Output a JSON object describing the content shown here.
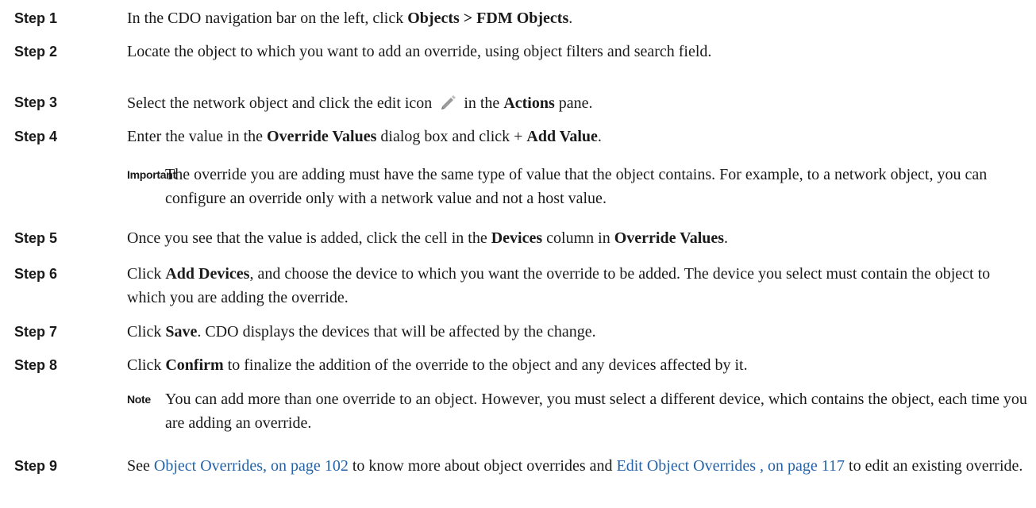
{
  "steps": [
    {
      "label": "Step 1",
      "parts": [
        {
          "t": "In the CDO navigation bar on the left, click "
        },
        {
          "t": "Objects > FDM Objects",
          "b": true
        },
        {
          "t": "."
        }
      ]
    },
    {
      "label": "Step 2",
      "parts": [
        {
          "t": "Locate the object to which you want to add an override, using object filters and search field."
        }
      ]
    },
    {
      "label": "Step 3",
      "parts": [
        {
          "t": "Select the network object and click the edit icon"
        },
        {
          "icon": "pencil-icon"
        },
        {
          "t": "in the "
        },
        {
          "t": "Actions",
          "b": true
        },
        {
          "t": " pane."
        }
      ]
    },
    {
      "label": "Step 4",
      "parts": [
        {
          "t": "Enter the value in the "
        },
        {
          "t": "Override Values",
          "b": true
        },
        {
          "t": " dialog box and click + "
        },
        {
          "t": "Add Value",
          "b": true
        },
        {
          "t": "."
        }
      ]
    },
    {
      "label": "Step 5",
      "parts": [
        {
          "t": "Once you see that the value is added, click the cell in the "
        },
        {
          "t": "Devices",
          "b": true
        },
        {
          "t": " column in "
        },
        {
          "t": "Override Values",
          "b": true
        },
        {
          "t": "."
        }
      ]
    },
    {
      "label": "Step 6",
      "parts": [
        {
          "t": "Click "
        },
        {
          "t": "Add Devices",
          "b": true
        },
        {
          "t": ", and choose the device to which you want the override to be added. The device you select must contain the object to which you are adding the override."
        }
      ]
    },
    {
      "label": "Step 7",
      "parts": [
        {
          "t": "Click "
        },
        {
          "t": "Save",
          "b": true
        },
        {
          "t": ". CDO displays the devices that will be affected by the change."
        }
      ]
    },
    {
      "label": "Step 8",
      "parts": [
        {
          "t": "Click "
        },
        {
          "t": "Confirm",
          "b": true
        },
        {
          "t": " to finalize the addition of the override to the object and any devices affected by it."
        }
      ]
    },
    {
      "label": "Step 9",
      "parts": [
        {
          "t": "See "
        },
        {
          "t": "Object Overrides, on page 102",
          "link": true
        },
        {
          "t": " to know more about object overrides and "
        },
        {
          "t": "Edit Object Overrides , on page 117",
          "link": true
        },
        {
          "t": " to edit an existing override."
        }
      ]
    }
  ],
  "callouts": {
    "important": {
      "label": "Important",
      "text": "The override you are adding must have the same type of value that the object contains. For example, to a network object, you can configure an override only with a network value and not a host value."
    },
    "note": {
      "label": "Note",
      "text": "You can add more than one override to an object. However, you must select a different device, which contains the object, each time you are adding an override."
    }
  },
  "colors": {
    "text": "#1a1a1a",
    "link": "#2563a8",
    "icon": "#9a9a9a"
  }
}
